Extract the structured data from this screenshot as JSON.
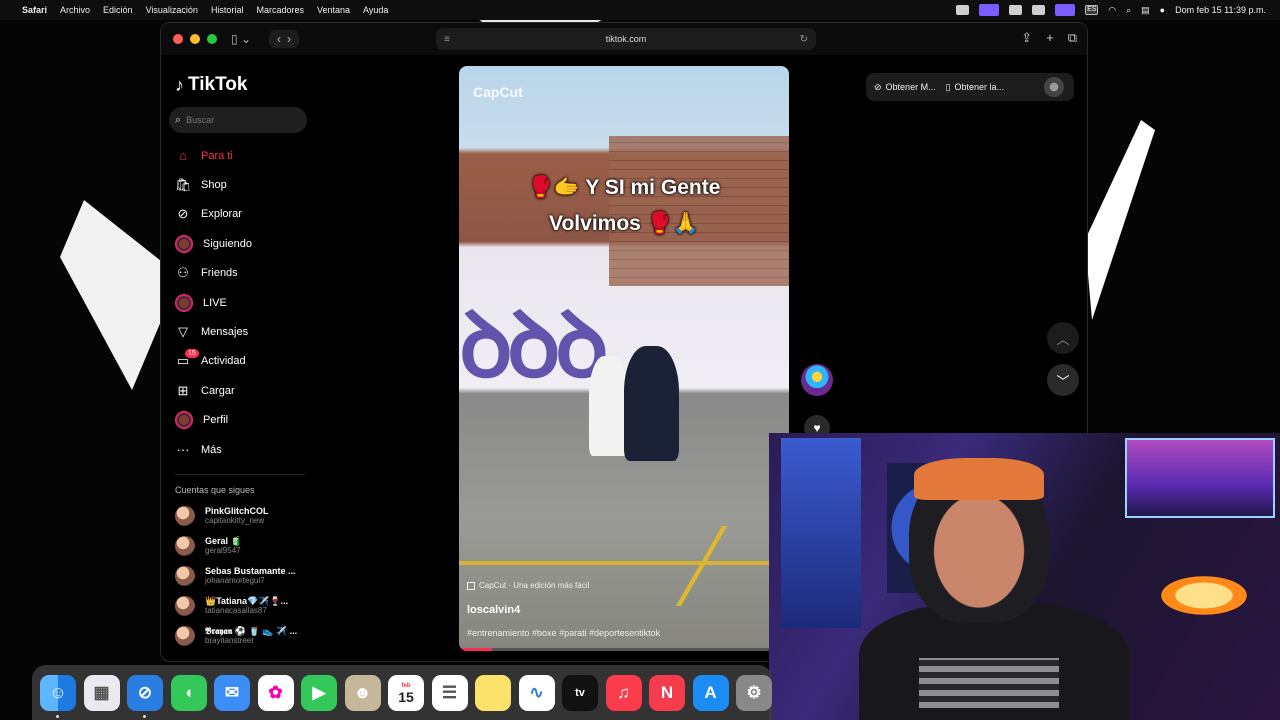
{
  "menubar": {
    "app": "Safari",
    "items": [
      "Archivo",
      "Edición",
      "Visualización",
      "Historial",
      "Marcadores",
      "Ventana",
      "Ayuda"
    ],
    "input_source": "ES",
    "clock": "Dom feb 15  11:39 p.m."
  },
  "browser": {
    "url": "tiktok.com"
  },
  "tiktok": {
    "brand": "TikTok",
    "search_placeholder": "Buscar",
    "nav": [
      {
        "label": "Para ti",
        "icon": "home-icon",
        "active": true
      },
      {
        "label": "Shop",
        "icon": "shop-icon"
      },
      {
        "label": "Explorar",
        "icon": "compass-icon"
      },
      {
        "label": "Siguiendo",
        "icon": "avatar-icon"
      },
      {
        "label": "Friends",
        "icon": "friends-icon"
      },
      {
        "label": "LIVE",
        "icon": "live-icon"
      },
      {
        "label": "Mensajes",
        "icon": "send-icon"
      },
      {
        "label": "Actividad",
        "icon": "inbox-icon",
        "badge": "15"
      },
      {
        "label": "Cargar",
        "icon": "plus-icon"
      },
      {
        "label": "Perfil",
        "icon": "profile-icon"
      },
      {
        "label": "Más",
        "icon": "more-icon"
      }
    ],
    "following_title": "Cuentas que sigues",
    "following": [
      {
        "name": "PinkGlitchCOL",
        "handle": "capitankitty_new"
      },
      {
        "name": "Geral 🧃",
        "handle": "geral9547"
      },
      {
        "name": "Sebas Bustamante ...",
        "handle": "johanamortegui7"
      },
      {
        "name": "👑Tatiana💎✈️🍷...",
        "handle": "tatianacasallas87"
      },
      {
        "name": "𝕭𝖗𝖆𝖞𝖆𝖓 ⚽ 🥤 👟 ✈️ ...",
        "handle": "brayitanstreet"
      }
    ],
    "get_buttons": [
      "Obtener M...",
      "Obtener la..."
    ]
  },
  "video": {
    "watermark": "CapCut",
    "caption_line1": "🥊🫱 Y SI mi Gente",
    "caption_line2": "Volvimos 🥊🙏",
    "meta": "CapCut · Una edición más fácil",
    "username": "loscalvin4",
    "hashtags": "#entrenamiento #boxe #parati #deportesentiktok",
    "progress": 0.1
  },
  "dock": [
    "Finder",
    "Launchpad",
    "Safari",
    "Mensajes",
    "Mail",
    "Fotos",
    "FaceTime",
    "Contactos",
    "Calendario",
    "Recordatorios",
    "Notas",
    "Freeform",
    "TV",
    "Música",
    "News",
    "App Store",
    "Ajustes"
  ],
  "calendar": {
    "month": "feb",
    "day": "15"
  },
  "colors": {
    "accent": "#fe2c55",
    "menu_bg": "#0e0e0e"
  }
}
